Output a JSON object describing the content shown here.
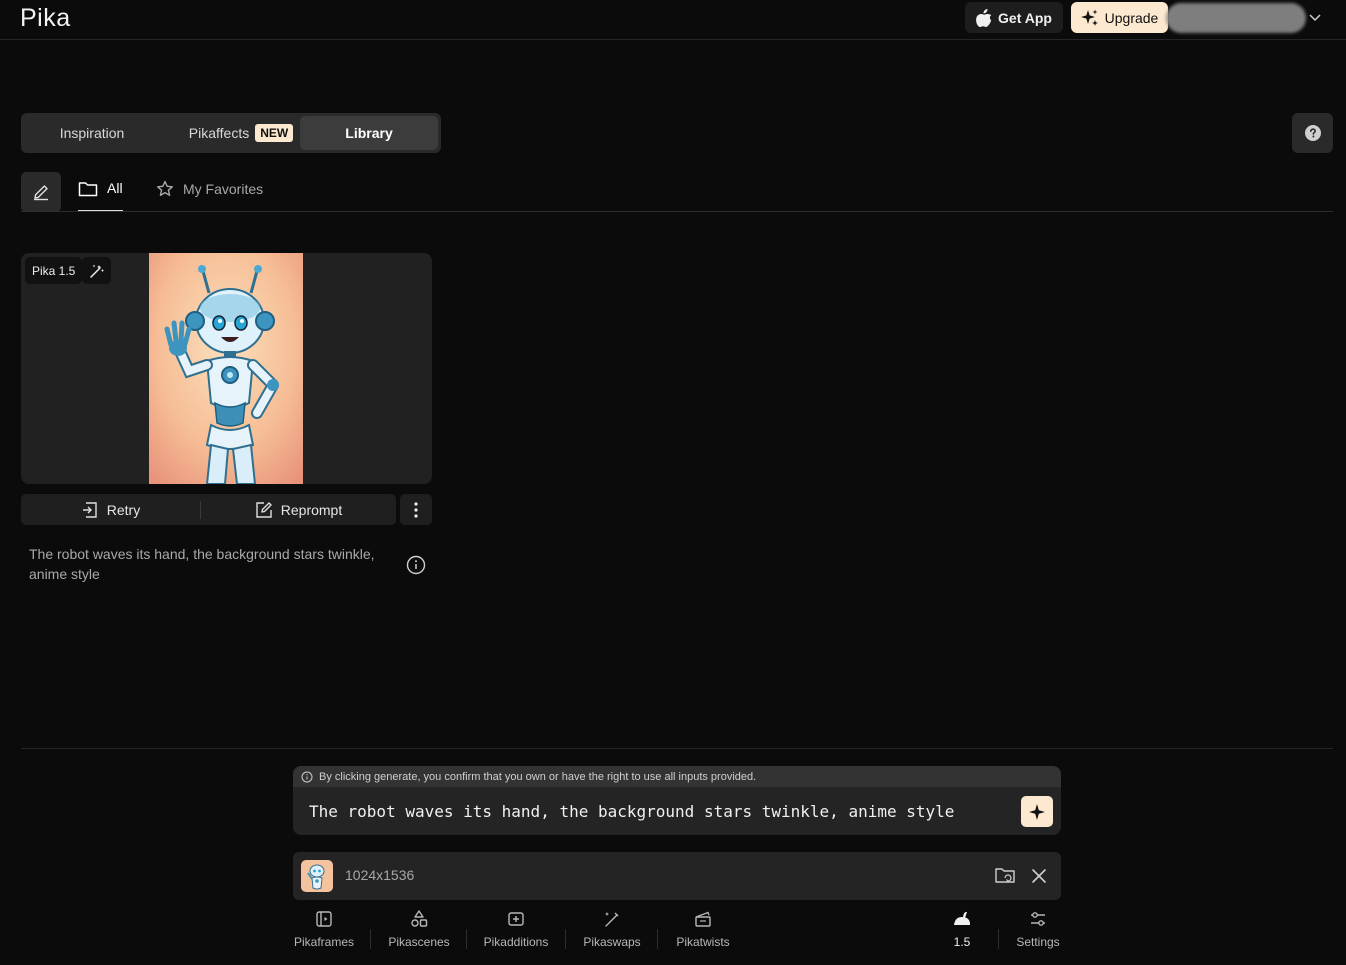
{
  "header": {
    "logo": "Pika",
    "get_app": "Get App",
    "upgrade": "Upgrade"
  },
  "tabs": {
    "inspiration": "Inspiration",
    "pikaffects": "Pikaffects",
    "pikaffects_badge": "NEW",
    "library": "Library"
  },
  "filters": {
    "all": "All",
    "favorites": "My Favorites"
  },
  "card": {
    "model": "Pika 1.5",
    "retry": "Retry",
    "reprompt": "Reprompt",
    "caption": "The robot waves its hand, the background stars twinkle, anime style"
  },
  "prompt": {
    "disclaimer": "By clicking generate, you confirm that you own or have the right to use all inputs provided.",
    "text": "The robot waves its hand, the background stars twinkle, anime style"
  },
  "image_input": {
    "size": "1024x1536"
  },
  "toolbar": {
    "pikaframes": "Pikaframes",
    "pikascenes": "Pikascenes",
    "pikadditions": "Pikadditions",
    "pikaswaps": "Pikaswaps",
    "pikatwists": "Pikatwists",
    "version": "1.5",
    "settings": "Settings"
  },
  "colors": {
    "background": "#0b0b0b",
    "accent": "#fde9cf",
    "panel": "#242424"
  }
}
